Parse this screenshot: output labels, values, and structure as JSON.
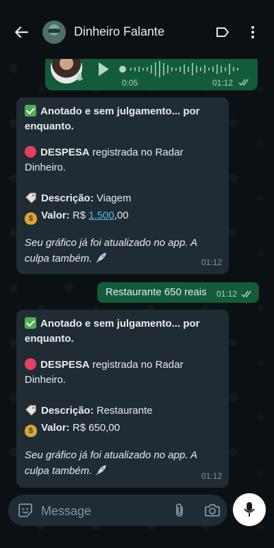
{
  "header": {
    "contact_name": "Dinheiro Falante"
  },
  "audio_message": {
    "duration": "0:05",
    "time": "01:12"
  },
  "messages": [
    {
      "title": "Anotado e sem julgamento... por enquanto.",
      "expense_label": "DESPESA",
      "expense_text": " registrada no Radar Dinheiro.",
      "description_label": "Descrição:",
      "description_value": " Viagem",
      "value_label": "Valor:",
      "value_prefix": " R$ ",
      "value_amount": "1.500",
      "value_cents": ",00",
      "note": "Seu gráfico já foi atualizado no app. A culpa também.",
      "time": "01:12"
    },
    {
      "title": "Anotado e sem julgamento... por enquanto.",
      "expense_label": "DESPESA",
      "expense_text": " registrada no Radar Dinheiro.",
      "description_label": "Descrição:",
      "description_value": " Restaurante",
      "value_label": "Valor:",
      "value_text": " R$ 650,00",
      "note": "Seu gráfico já foi atualizado no app. A culpa também.",
      "time": "01:12"
    }
  ],
  "outgoing": {
    "text": "Restaurante 650 reais",
    "time": "01:12"
  },
  "composer": {
    "placeholder": "Message"
  },
  "colors": {
    "background": "#0b1014",
    "incoming_bubble": "#202c33",
    "outgoing_bubble": "#135c3a",
    "link": "#53bdeb"
  }
}
